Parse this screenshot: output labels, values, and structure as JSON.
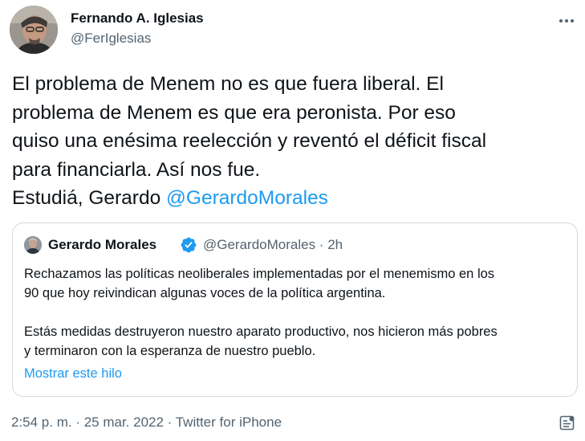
{
  "author": {
    "name": "Fernando A. Iglesias",
    "handle": "@FerIglesias"
  },
  "tweet": {
    "lines": [
      "El problema de Menem no es que fuera liberal. El",
      "problema de Menem es que era peronista. Por eso",
      "quiso una enésima reelección y reventó el déficit fiscal",
      "para financiarla. Así nos fue."
    ],
    "closing_text": "Estudiá, Gerardo ",
    "mention": "@GerardoMorales"
  },
  "quoted_tweet": {
    "name": "Gerardo Morales",
    "meta": "@GerardoMorales · 2h",
    "paragraph1": [
      "Rechazamos las políticas neoliberales implementadas por el menemismo en los",
      "90 que hoy reivindican algunas voces de la política argentina."
    ],
    "paragraph2": [
      "Estás medidas destruyeron nuestro aparato productivo, nos hicieron más pobres",
      "y terminaron con la esperanza de nuestro pueblo."
    ],
    "show_thread": "Mostrar este hilo"
  },
  "footer": {
    "meta": "2:54 p. m. · 25 mar. 2022 · Twitter for iPhone"
  },
  "icons": {
    "more": "more-horizontal-icon",
    "verified": "verified-badge-icon",
    "analytics": "analytics-icon"
  },
  "colors": {
    "text": "#0f1419",
    "secondary": "#536471",
    "link": "#1d9bf0",
    "border": "#cfd9de"
  }
}
